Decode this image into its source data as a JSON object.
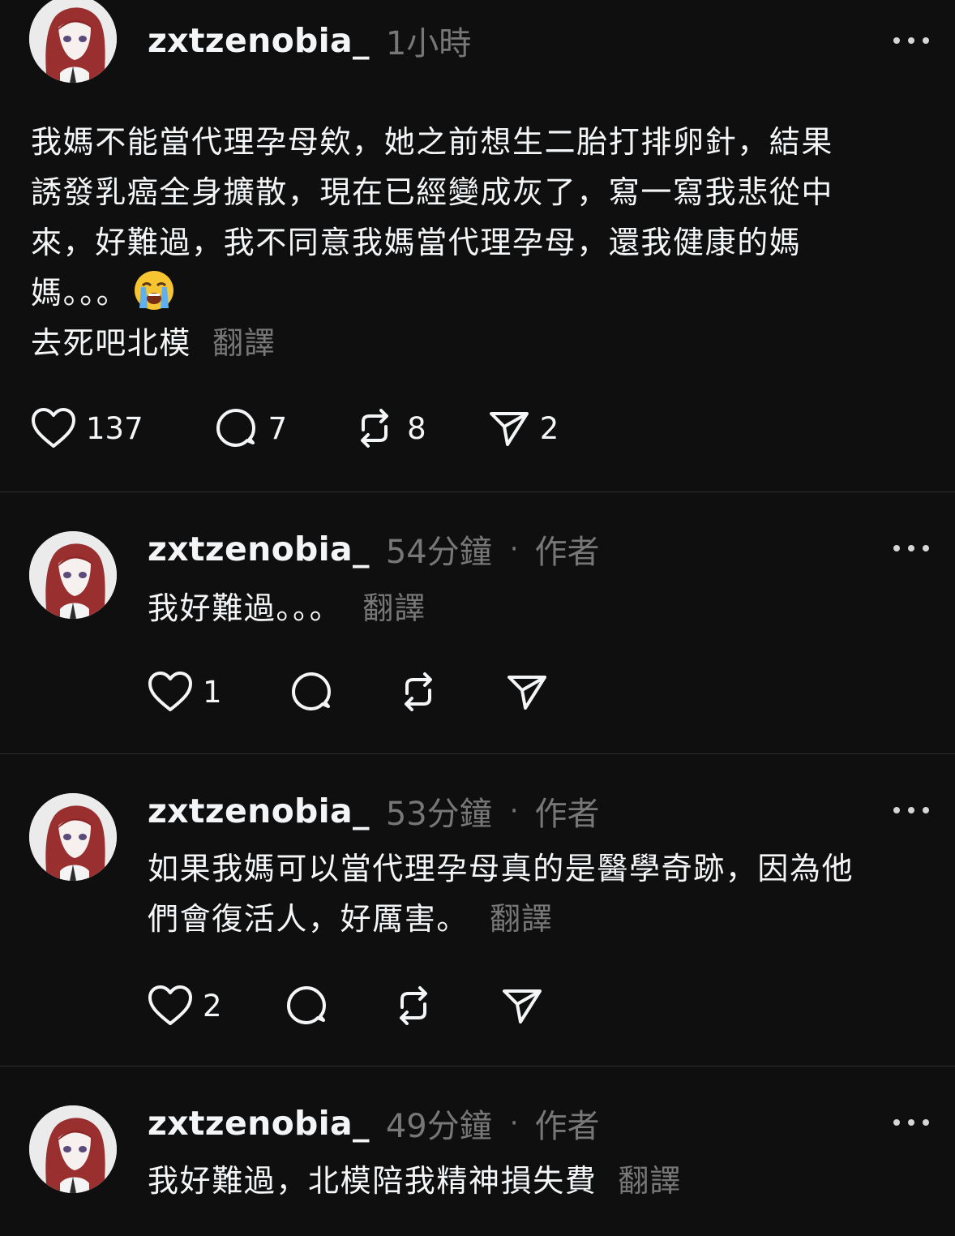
{
  "main_post": {
    "username": "zxtzenobia_",
    "time": "1小時",
    "lines": [
      "我媽不能當代理孕母欸，她之前想生二胎打排卵針，結果",
      "誘發乳癌全身擴散，現在已經變成灰了，寫一寫我悲從中",
      "來，好難過，我不同意我媽當代理孕母，還我健康的媽",
      "媽。。。",
      "去死吧北模"
    ],
    "emoji": "loudly-crying-face",
    "translate_label": "翻譯",
    "likes": "137",
    "replies": "7",
    "reposts": "8",
    "shares": "2"
  },
  "replies": [
    {
      "username": "zxtzenobia_",
      "time": "54分鐘",
      "separator": "·",
      "author_label": "作者",
      "lines": [
        "我好難過。。。"
      ],
      "translate_label": "翻譯",
      "likes": "1"
    },
    {
      "username": "zxtzenobia_",
      "time": "53分鐘",
      "separator": "·",
      "author_label": "作者",
      "lines": [
        "如果我媽可以當代理孕母真的是醫學奇跡，因為他",
        "們會復活人，好厲害。"
      ],
      "translate_label": "翻譯",
      "likes": "2"
    },
    {
      "username": "zxtzenobia_",
      "time": "49分鐘",
      "separator": "·",
      "author_label": "作者",
      "lines": [
        "我好難過，北模陪我精神損失費"
      ],
      "translate_label": "翻譯"
    }
  ],
  "colors": {
    "background": "#0f0f0f",
    "text": "#f3f5f7",
    "muted": "#777777",
    "divider": "#2d2d2d"
  }
}
